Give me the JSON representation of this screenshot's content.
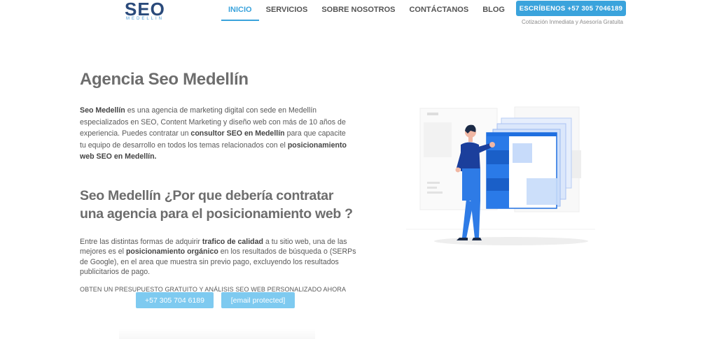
{
  "logo": {
    "text": "SEO",
    "subtext": "MEDELLIN"
  },
  "nav": {
    "items": [
      {
        "label": "INICIO",
        "active": true
      },
      {
        "label": "SERVICIOS",
        "active": false
      },
      {
        "label": "SOBRE NOSOTROS",
        "active": false
      },
      {
        "label": "CONTÁCTANOS",
        "active": false
      },
      {
        "label": "BLOG",
        "active": false
      }
    ]
  },
  "header_cta": {
    "button": "ESCRÍBENOS +57 305 7046189",
    "subtext": "Cotización Inmediata y Asesoría Gratuita"
  },
  "main": {
    "title": "Agencia Seo Medellín",
    "intro": {
      "part1_bold": "Seo Medellín",
      "part2": " es una agencia de marketing digital con sede en Medellín especializados en SEO, Content Marketing y diseño web con más de 10 años de experiencia.  Puedes contratar un ",
      "part3_bold": "consultor SEO en Medellín",
      "part4": " para que capacite tu equipo de desarrollo en todos los temas relacionados con el ",
      "part5_bold": "posicionamiento web SEO en Medellín."
    },
    "subtitle": "Seo Medellín ¿Por que debería contratar una agencia para el posicionamiento web ?",
    "body": {
      "part1": "Entre las distintas formas de adquirir ",
      "part2_bold": "trafico de calidad",
      "part3": " a tu sitio web, una de las mejores es el ",
      "part4_bold": "posicionamiento orgánico",
      "part5": " en los resultados de búsqueda o (SERPs de Google), en el area que muestra sin previo pago, excluyendo los resultados publicitarios de pago."
    },
    "offer": "OBTEN UN PRESUPUESTO GRATUITO Y ANÁLISIS SEO WEB PERSONALIZADO AHORA",
    "buttons": {
      "phone": "+57 305 704 6189",
      "email": "[email protected]"
    }
  },
  "colors": {
    "accent": "#3aa3dc",
    "button_light": "#7ecaf0",
    "illustration_blue": "#1f6fe0"
  }
}
